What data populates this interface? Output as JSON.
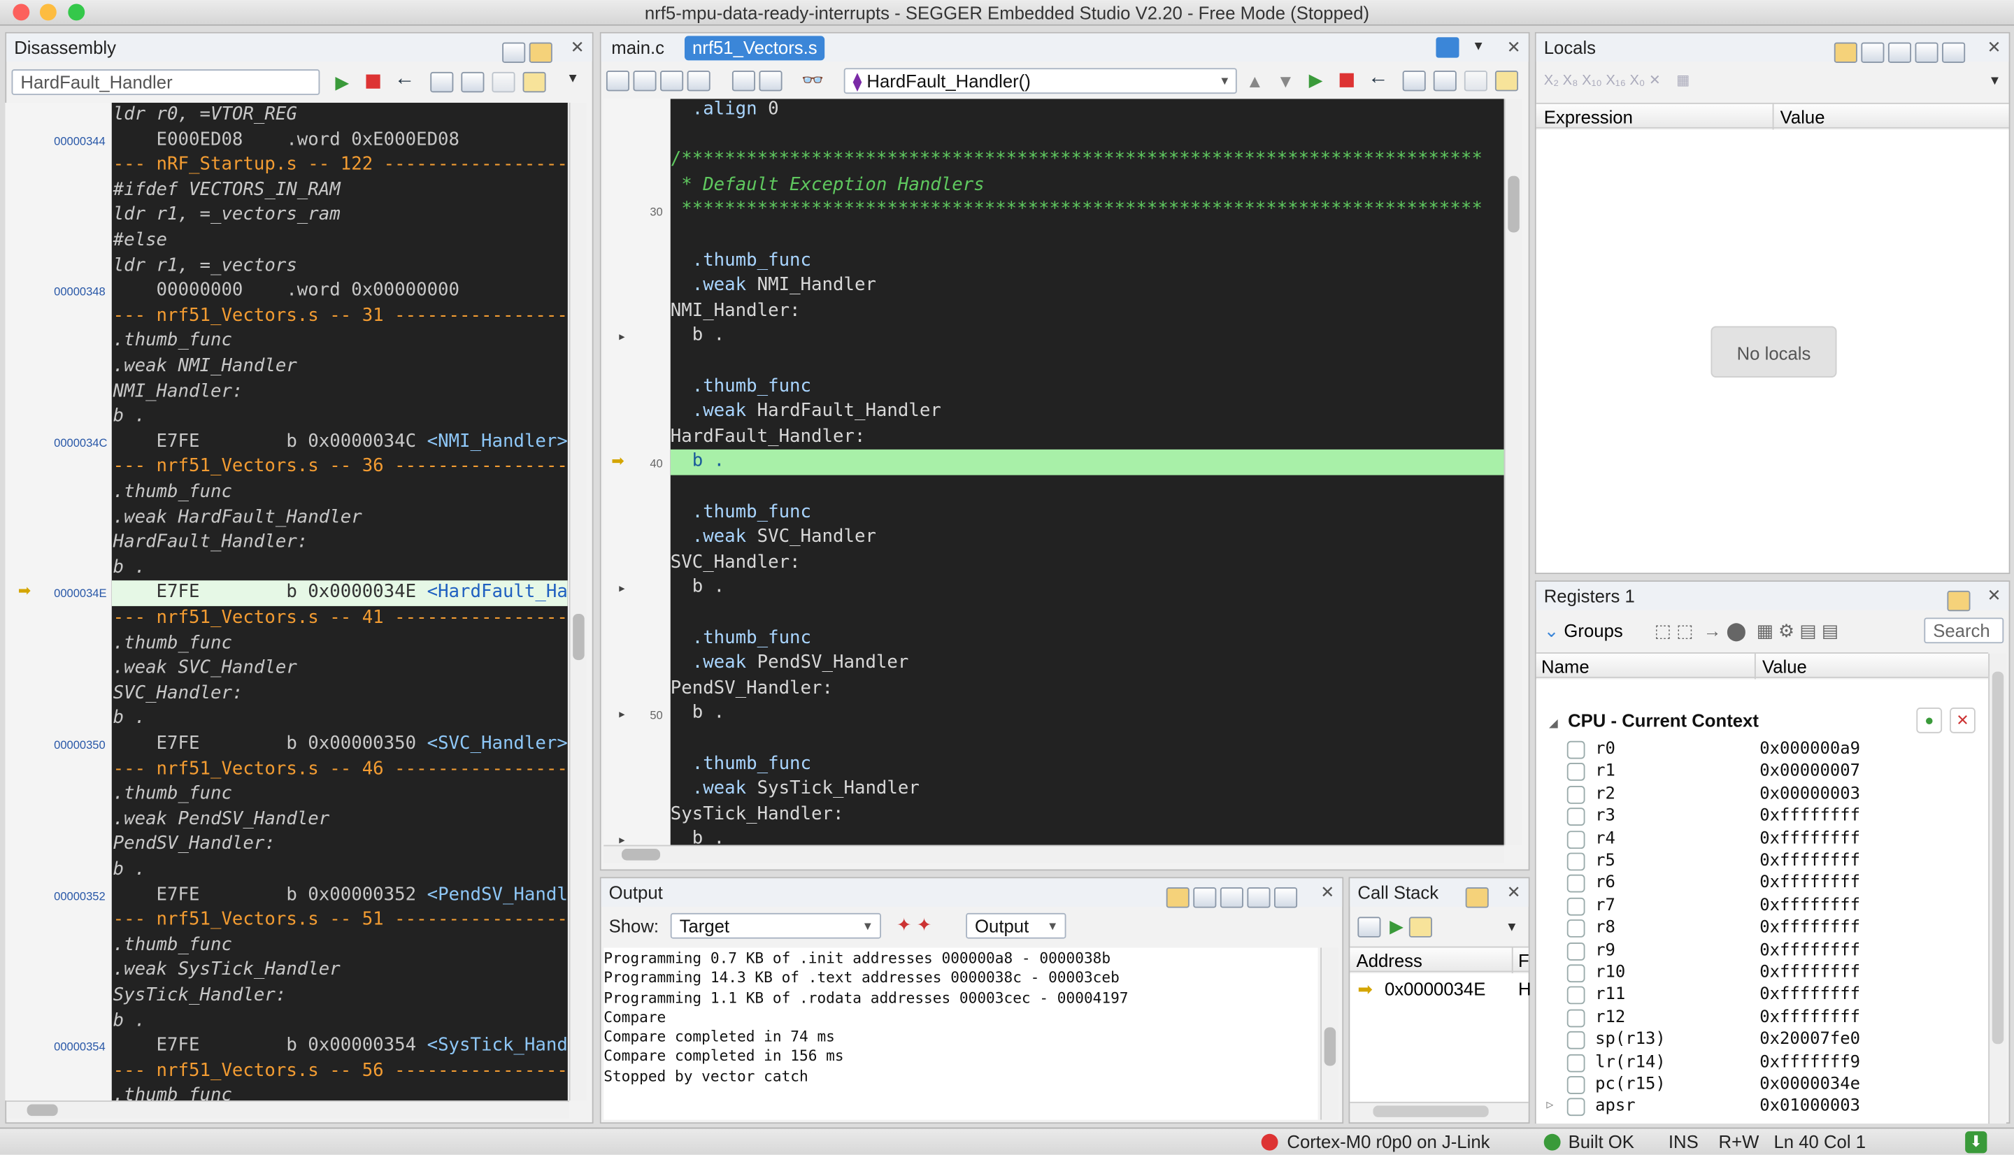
{
  "window": {
    "title": "nrf5-mpu-data-ready-interrupts - SEGGER Embedded Studio V2.20 - Free Mode (Stopped)"
  },
  "disassembly": {
    "title": "Disassembly",
    "location_input": "HardFault_Handler",
    "lines": [
      {
        "addr": "",
        "text": "ldr r0, =VTOR_REG",
        "kind": "src"
      },
      {
        "addr": "00000344",
        "text": "    E000ED08    .word 0xE000ED08",
        "kind": "asm"
      },
      {
        "addr": "",
        "text": "--- nRF_Startup.s -- 122 ----------------------",
        "kind": "file"
      },
      {
        "addr": "",
        "text": "#ifdef VECTORS_IN_RAM",
        "kind": "src"
      },
      {
        "addr": "",
        "text": "ldr r1, =_vectors_ram",
        "kind": "src"
      },
      {
        "addr": "",
        "text": "#else",
        "kind": "src"
      },
      {
        "addr": "",
        "text": "ldr r1, =_vectors",
        "kind": "src"
      },
      {
        "addr": "00000348",
        "text": "    00000000    .word 0x00000000",
        "kind": "asm"
      },
      {
        "addr": "",
        "text": "--- nrf51_Vectors.s -- 31 ----------------------",
        "kind": "file"
      },
      {
        "addr": "",
        "text": ".thumb_func",
        "kind": "src"
      },
      {
        "addr": "",
        "text": ".weak NMI_Handler",
        "kind": "src"
      },
      {
        "addr": "",
        "text": "NMI_Handler:",
        "kind": "src"
      },
      {
        "addr": "",
        "text": "b .",
        "kind": "src"
      },
      {
        "addr": "0000034C",
        "text": "    E7FE        b 0x0000034C ",
        "sym": "<NMI_Handler>",
        "kind": "asm"
      },
      {
        "addr": "",
        "text": "--- nrf51_Vectors.s -- 36 ----------------------",
        "kind": "file"
      },
      {
        "addr": "",
        "text": ".thumb_func",
        "kind": "src"
      },
      {
        "addr": "",
        "text": ".weak HardFault_Handler",
        "kind": "src"
      },
      {
        "addr": "",
        "text": "HardFault_Handler:",
        "kind": "src"
      },
      {
        "addr": "",
        "text": "b .",
        "kind": "src"
      },
      {
        "addr": "0000034E",
        "text": "    E7FE        b 0x0000034E ",
        "sym": "<HardFault_Handler>",
        "kind": "cur"
      },
      {
        "addr": "",
        "text": "--- nrf51_Vectors.s -- 41 ----------------------",
        "kind": "file"
      },
      {
        "addr": "",
        "text": ".thumb_func",
        "kind": "src"
      },
      {
        "addr": "",
        "text": ".weak SVC_Handler",
        "kind": "src"
      },
      {
        "addr": "",
        "text": "SVC_Handler:",
        "kind": "src"
      },
      {
        "addr": "",
        "text": "b .",
        "kind": "src"
      },
      {
        "addr": "00000350",
        "text": "    E7FE        b 0x00000350 ",
        "sym": "<SVC_Handler>",
        "kind": "asm"
      },
      {
        "addr": "",
        "text": "--- nrf51_Vectors.s -- 46 ----------------------",
        "kind": "file"
      },
      {
        "addr": "",
        "text": ".thumb_func",
        "kind": "src"
      },
      {
        "addr": "",
        "text": ".weak PendSV_Handler",
        "kind": "src"
      },
      {
        "addr": "",
        "text": "PendSV_Handler:",
        "kind": "src"
      },
      {
        "addr": "",
        "text": "b .",
        "kind": "src"
      },
      {
        "addr": "00000352",
        "text": "    E7FE        b 0x00000352 ",
        "sym": "<PendSV_Handler>",
        "kind": "asm"
      },
      {
        "addr": "",
        "text": "--- nrf51_Vectors.s -- 51 ----------------------",
        "kind": "file"
      },
      {
        "addr": "",
        "text": ".thumb_func",
        "kind": "src"
      },
      {
        "addr": "",
        "text": ".weak SysTick_Handler",
        "kind": "src"
      },
      {
        "addr": "",
        "text": "SysTick_Handler:",
        "kind": "src"
      },
      {
        "addr": "",
        "text": "b .",
        "kind": "src"
      },
      {
        "addr": "00000354",
        "text": "    E7FE        b 0x00000354 ",
        "sym": "<SysTick_Handler>",
        "kind": "asm"
      },
      {
        "addr": "",
        "text": "--- nrf51_Vectors.s -- 56 ----------------------",
        "kind": "file"
      },
      {
        "addr": "",
        "text": ".thumb_func",
        "kind": "src"
      }
    ]
  },
  "editor": {
    "tabs": [
      {
        "label": "main.c",
        "active": false
      },
      {
        "label": "nrf51_Vectors.s",
        "active": true
      }
    ],
    "function_selector": "HardFault_Handler()",
    "lines": [
      {
        "n": "",
        "text": "  .align 0",
        "kind": "dir"
      },
      {
        "n": "",
        "text": "",
        "kind": "blank"
      },
      {
        "n": "",
        "text": "/**************************************************************************",
        "kind": "cmt"
      },
      {
        "n": "",
        "text": " * Default Exception Handlers",
        "kind": "cmt"
      },
      {
        "n": "30",
        "text": " **************************************************************************",
        "kind": "cmt"
      },
      {
        "n": "",
        "text": "",
        "kind": "blank"
      },
      {
        "n": "",
        "text": "  .thumb_func",
        "kind": "dir"
      },
      {
        "n": "",
        "text": "  .weak NMI_Handler",
        "kind": "dir"
      },
      {
        "n": "",
        "text": "NMI_Handler:",
        "kind": "lbl"
      },
      {
        "n": "",
        "text": "  b .",
        "kind": "code",
        "bp": true
      },
      {
        "n": "",
        "text": "",
        "kind": "blank"
      },
      {
        "n": "",
        "text": "  .thumb_func",
        "kind": "dir"
      },
      {
        "n": "",
        "text": "  .weak HardFault_Handler",
        "kind": "dir"
      },
      {
        "n": "",
        "text": "HardFault_Handler:",
        "kind": "lbl"
      },
      {
        "n": "40",
        "text": "  b .",
        "kind": "cur"
      },
      {
        "n": "",
        "text": "",
        "kind": "blank"
      },
      {
        "n": "",
        "text": "  .thumb_func",
        "kind": "dir"
      },
      {
        "n": "",
        "text": "  .weak SVC_Handler",
        "kind": "dir"
      },
      {
        "n": "",
        "text": "SVC_Handler:",
        "kind": "lbl"
      },
      {
        "n": "",
        "text": "  b .",
        "kind": "code",
        "bp": true
      },
      {
        "n": "",
        "text": "",
        "kind": "blank"
      },
      {
        "n": "",
        "text": "  .thumb_func",
        "kind": "dir"
      },
      {
        "n": "",
        "text": "  .weak PendSV_Handler",
        "kind": "dir"
      },
      {
        "n": "",
        "text": "PendSV_Handler:",
        "kind": "lbl"
      },
      {
        "n": "50",
        "text": "  b .",
        "kind": "code",
        "bp": true
      },
      {
        "n": "",
        "text": "",
        "kind": "blank"
      },
      {
        "n": "",
        "text": "  .thumb_func",
        "kind": "dir"
      },
      {
        "n": "",
        "text": "  .weak SysTick_Handler",
        "kind": "dir"
      },
      {
        "n": "",
        "text": "SysTick_Handler:",
        "kind": "lbl"
      },
      {
        "n": "",
        "text": "  b .",
        "kind": "code",
        "bp": true
      }
    ]
  },
  "locals": {
    "title": "Locals",
    "col_expression": "Expression",
    "col_value": "Value",
    "empty_text": "No locals"
  },
  "registers": {
    "title": "Registers 1",
    "groups_label": "Groups",
    "search_placeholder": "Search",
    "col_name": "Name",
    "col_value": "Value",
    "group": "CPU - Current Context",
    "items": [
      {
        "name": "r0",
        "value": "0x000000a9"
      },
      {
        "name": "r1",
        "value": "0x00000007"
      },
      {
        "name": "r2",
        "value": "0x00000003"
      },
      {
        "name": "r3",
        "value": "0xffffffff"
      },
      {
        "name": "r4",
        "value": "0xffffffff"
      },
      {
        "name": "r5",
        "value": "0xffffffff"
      },
      {
        "name": "r6",
        "value": "0xffffffff"
      },
      {
        "name": "r7",
        "value": "0xffffffff"
      },
      {
        "name": "r8",
        "value": "0xffffffff"
      },
      {
        "name": "r9",
        "value": "0xffffffff"
      },
      {
        "name": "r10",
        "value": "0xffffffff"
      },
      {
        "name": "r11",
        "value": "0xffffffff"
      },
      {
        "name": "r12",
        "value": "0xffffffff"
      },
      {
        "name": "sp(r13)",
        "value": "0x20007fe0"
      },
      {
        "name": "lr(r14)",
        "value": "0xfffffff9"
      },
      {
        "name": "pc(r15)",
        "value": "0x0000034e"
      },
      {
        "name": "apsr",
        "value": "0x01000003"
      }
    ]
  },
  "output": {
    "title": "Output",
    "show_label": "Show:",
    "show_value": "Target",
    "second_dropdown": "Output",
    "text_lines": [
      "Programming 0.7 KB of .init addresses 000000a8 - 0000038b",
      "Programming 14.3 KB of .text addresses 0000038c - 00003ceb",
      "Programming 1.1 KB of .rodata addresses 00003cec - 00004197",
      "Compare",
      "Compare completed in 74 ms",
      "Compare completed in 156 ms",
      "Stopped by vector catch"
    ]
  },
  "callstack": {
    "title": "Call Stack",
    "col_address": "Address",
    "col_f": "F",
    "row_address": "0x0000034E",
    "row_f": "H"
  },
  "statusbar": {
    "target": "Cortex-M0 r0p0 on J-Link",
    "build": "Built OK",
    "mode": "INS",
    "rw": "R+W",
    "position": "Ln 40 Col 1"
  },
  "colors": {
    "accent": "#3b86d8",
    "current_line": "#a8f0a8",
    "file_marker": "#f39c32",
    "editor_bg": "#222222"
  }
}
